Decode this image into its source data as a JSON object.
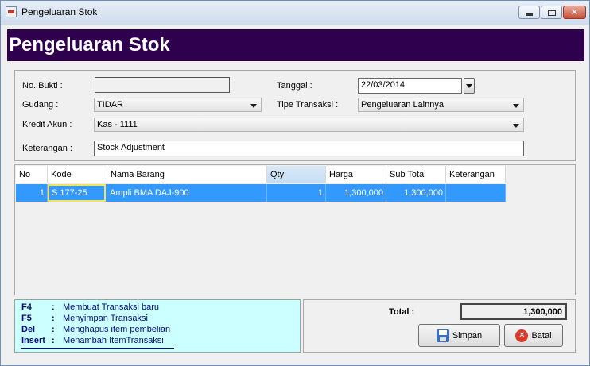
{
  "window": {
    "title": "Pengeluaran Stok"
  },
  "banner": {
    "title": "Pengeluaran Stok"
  },
  "form": {
    "no_bukti_label": "No. Bukti :",
    "no_bukti_value": "",
    "tanggal_label": "Tanggal :",
    "tanggal_value": "22/03/2014",
    "gudang_label": "Gudang :",
    "gudang_value": "TIDAR",
    "tipe_transaksi_label": "Tipe Transaksi :",
    "tipe_transaksi_value": "Pengeluaran Lainnya",
    "kredit_akun_label": "Kredit Akun :",
    "kredit_akun_value": "Kas - 1111",
    "keterangan_label": "Keterangan :",
    "keterangan_value": "Stock Adjustment"
  },
  "table": {
    "columns": [
      "No",
      "Kode",
      "Nama Barang",
      "Qty",
      "Harga",
      "Sub Total",
      "Keterangan"
    ],
    "rows": [
      {
        "no": "1",
        "kode": "S 177-25",
        "nama_barang": "Ampli BMA DAJ-900",
        "qty": "1",
        "harga": "1,300,000",
        "sub_total": "1,300,000",
        "keterangan": ""
      }
    ]
  },
  "help": [
    {
      "key": "F4",
      "desc": "Membuat Transaksi baru"
    },
    {
      "key": "F5",
      "desc": "Menyimpan Transaksi"
    },
    {
      "key": "Del",
      "desc": "Menghapus item pembelian"
    },
    {
      "key": "Insert",
      "desc": "Menambah ItemTransaksi"
    }
  ],
  "help_separator": ":",
  "total": {
    "label": "Total :",
    "value": "1,300,000"
  },
  "buttons": {
    "simpan": "Simpan",
    "batal": "Batal"
  },
  "icons": {
    "save": "save-disk-icon",
    "cancel": "cancel-x-icon"
  },
  "colors": {
    "banner": "#2e004d",
    "selected_row": "#3399ff",
    "help_bg": "#ccffff",
    "help_text": "#000a7a"
  }
}
